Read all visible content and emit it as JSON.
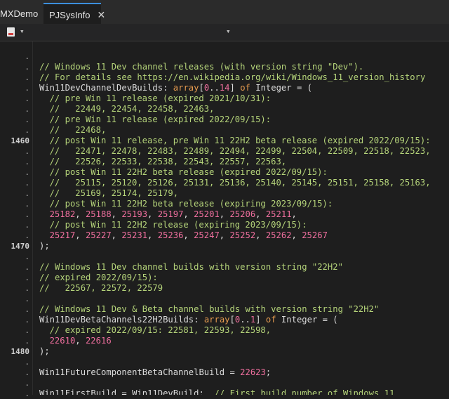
{
  "tabs": [
    {
      "label": "MXDemo",
      "modified": true
    },
    {
      "label": "PJSysInfo",
      "active": true
    }
  ],
  "gutter": [
    ".",
    ".",
    ".",
    ".",
    ".",
    ".",
    ".",
    ".",
    "1460",
    ".",
    ".",
    ".",
    ".",
    ".",
    ".",
    ".",
    ".",
    ".",
    "1470",
    ".",
    ".",
    ".",
    ".",
    ".",
    ".",
    ".",
    ".",
    ".",
    "1480",
    ".",
    ".",
    ".",
    "."
  ],
  "lines": [
    [],
    [
      [
        "comment",
        "// Windows 11 Dev channel releases (with version string \"Dev\").",
        0
      ]
    ],
    [
      [
        "comment",
        "// For details see https://en.wikipedia.org/wiki/Windows_11_version_history",
        0
      ]
    ],
    [
      [
        "plain",
        "Win11DevChannelDevBuilds: ",
        0
      ],
      [
        "kw",
        "array",
        0
      ],
      [
        "plain",
        "[",
        0
      ],
      [
        "num",
        "0",
        0
      ],
      [
        "plain",
        "..",
        0
      ],
      [
        "num",
        "14",
        0
      ],
      [
        "plain",
        "] ",
        0
      ],
      [
        "kw",
        "of",
        0
      ],
      [
        "plain",
        " Integer = (",
        0
      ]
    ],
    [
      [
        "comment",
        "// pre Win 11 release (expired 2021/10/31):",
        2
      ]
    ],
    [
      [
        "comment",
        "//   22449, 22454, 22458, 22463,",
        2
      ]
    ],
    [
      [
        "comment",
        "// pre Win 11 release (expired 2022/09/15):",
        2
      ]
    ],
    [
      [
        "comment",
        "//   22468,",
        2
      ]
    ],
    [
      [
        "comment",
        "// post Win 11 release, pre Win 11 22H2 beta release (expired 2022/09/15):",
        2
      ]
    ],
    [
      [
        "comment",
        "//   22471, 22478, 22483, 22489, 22494, 22499, 22504, 22509, 22518, 22523,",
        2
      ]
    ],
    [
      [
        "comment",
        "//   22526, 22533, 22538, 22543, 22557, 22563,",
        2
      ]
    ],
    [
      [
        "comment",
        "// post Win 11 22H2 beta release (expired 2022/09/15):",
        2
      ]
    ],
    [
      [
        "comment",
        "//   25115, 25120, 25126, 25131, 25136, 25140, 25145, 25151, 25158, 25163,",
        2
      ]
    ],
    [
      [
        "comment",
        "//   25169, 25174, 25179,",
        2
      ]
    ],
    [
      [
        "comment",
        "// post Win 11 22H2 beta release (expiring 2023/09/15):",
        2
      ]
    ],
    [
      [
        "num",
        "25182",
        2
      ],
      [
        "plain",
        ", ",
        0
      ],
      [
        "num",
        "25188",
        0
      ],
      [
        "plain",
        ", ",
        0
      ],
      [
        "num",
        "25193",
        0
      ],
      [
        "plain",
        ", ",
        0
      ],
      [
        "num",
        "25197",
        0
      ],
      [
        "plain",
        ", ",
        0
      ],
      [
        "num",
        "25201",
        0
      ],
      [
        "plain",
        ", ",
        0
      ],
      [
        "num",
        "25206",
        0
      ],
      [
        "plain",
        ", ",
        0
      ],
      [
        "num",
        "25211",
        0
      ],
      [
        "plain",
        ",",
        0
      ]
    ],
    [
      [
        "comment",
        "// post Win 11 22H2 release (expiring 2023/09/15):",
        2
      ]
    ],
    [
      [
        "num",
        "25217",
        2
      ],
      [
        "plain",
        ", ",
        0
      ],
      [
        "num",
        "25227",
        0
      ],
      [
        "plain",
        ", ",
        0
      ],
      [
        "num",
        "25231",
        0
      ],
      [
        "plain",
        ", ",
        0
      ],
      [
        "num",
        "25236",
        0
      ],
      [
        "plain",
        ", ",
        0
      ],
      [
        "num",
        "25247",
        0
      ],
      [
        "plain",
        ", ",
        0
      ],
      [
        "num",
        "25252",
        0
      ],
      [
        "plain",
        ", ",
        0
      ],
      [
        "num",
        "25262",
        0
      ],
      [
        "plain",
        ", ",
        0
      ],
      [
        "num",
        "25267",
        0
      ]
    ],
    [
      [
        "plain",
        ");",
        0
      ]
    ],
    [],
    [
      [
        "comment",
        "// Windows 11 Dev channel builds with version string \"22H2\"",
        0
      ]
    ],
    [
      [
        "comment",
        "// expired 2022/09/15):",
        0
      ]
    ],
    [
      [
        "comment",
        "//   22567, 22572, 22579",
        0
      ]
    ],
    [],
    [
      [
        "comment",
        "// Windows 11 Dev & Beta channel builds with version string \"22H2\"",
        0
      ]
    ],
    [
      [
        "plain",
        "Win11DevBetaChannels22H2Builds: ",
        0
      ],
      [
        "kw",
        "array",
        0
      ],
      [
        "plain",
        "[",
        0
      ],
      [
        "num",
        "0",
        0
      ],
      [
        "plain",
        "..",
        0
      ],
      [
        "num",
        "1",
        0
      ],
      [
        "plain",
        "] ",
        0
      ],
      [
        "kw",
        "of",
        0
      ],
      [
        "plain",
        " Integer = (",
        0
      ]
    ],
    [
      [
        "comment",
        "// expired 2022/09/15: 22581, 22593, 22598,",
        2
      ]
    ],
    [
      [
        "num",
        "22610",
        2
      ],
      [
        "plain",
        ", ",
        0
      ],
      [
        "num",
        "22616",
        0
      ]
    ],
    [
      [
        "plain",
        ");",
        0
      ]
    ],
    [],
    [
      [
        "plain",
        "Win11FutureComponentBetaChannelBuild = ",
        0
      ],
      [
        "num",
        "22623",
        0
      ],
      [
        "plain",
        ";",
        0
      ]
    ],
    [],
    [
      [
        "plain",
        "Win11FirstBuild = Win11DevBuild;  ",
        0
      ],
      [
        "comment",
        "// First build number of Windows 11",
        0
      ]
    ]
  ]
}
